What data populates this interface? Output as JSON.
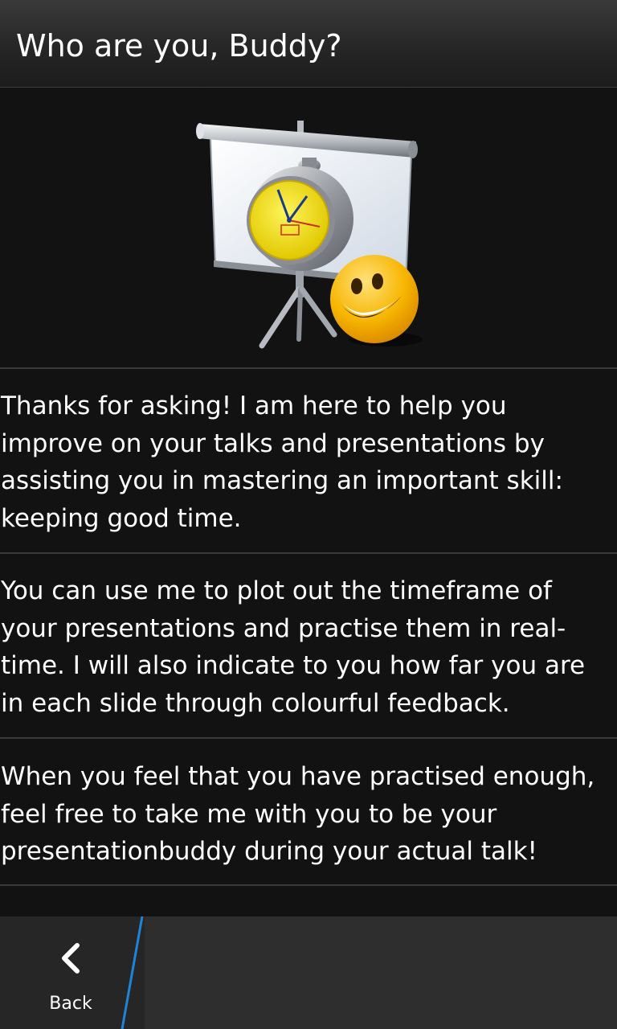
{
  "header": {
    "title": "Who are you, Buddy?"
  },
  "hero": {
    "icon": "presentation-screen-with-clock-and-smiley-icon",
    "colors": {
      "clock_face": "#f2e020",
      "smiley": "#f7b500"
    }
  },
  "content": {
    "paragraphs": [
      {
        "lines": [
          "Thanks for asking! I am here to help you",
          "improve on your talks and presentations by",
          "assisting you in mastering an important skill:",
          "keeping good time."
        ]
      },
      {
        "lines": [
          "You can use me to plot out the timeframe of",
          "your presentations and practise them in real-",
          "time. I will also indicate to you how far you are",
          "in each slide through colourful feedback."
        ]
      },
      {
        "lines": [
          "When you feel that you have practised enough,",
          "feel free to take me with you to be your",
          "presentationbuddy during your actual talk!"
        ]
      }
    ]
  },
  "action_bar": {
    "back_label": "Back",
    "back_icon": "chevron-left-icon",
    "accent_color": "#1f84d6"
  }
}
